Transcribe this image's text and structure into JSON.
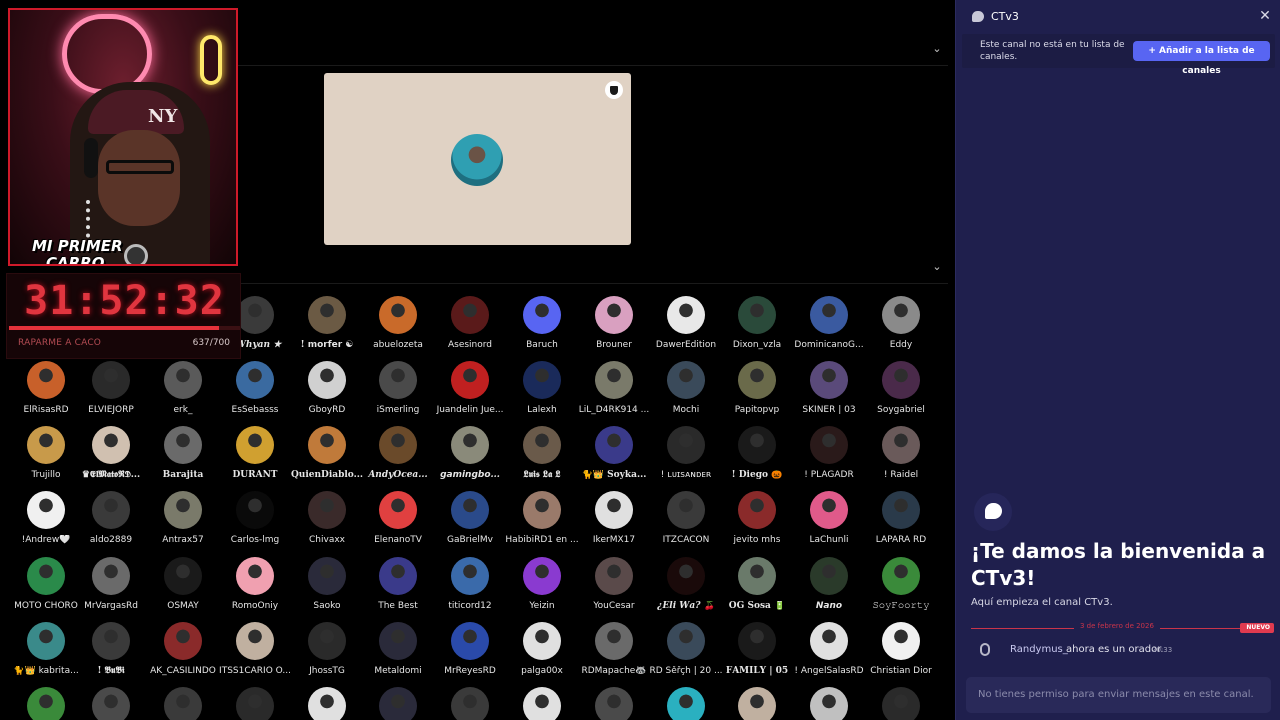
{
  "webcam": {
    "overlay_text_line1": "MI PRIMER",
    "overlay_text_line2": "CARRO",
    "cap_logo": "NY"
  },
  "timer": {
    "time": "31:52:32",
    "label": "RAPARME A CACO",
    "count": "637/700",
    "progress": 0.91
  },
  "stage": {
    "accent_color": "#e0d2c4"
  },
  "audience": {
    "members": [
      {
        "name": "! 𝑾𝒉𝒚𝒂𝒏 ★",
        "style": "italic",
        "color": "#3a3a3a"
      },
      {
        "name": "! 𝗺𝗼𝗿𝗳𝗲𝗿 ☯",
        "style": "bold",
        "color": "#6b5a44"
      },
      {
        "name": "abuelozeta",
        "style": "",
        "color": "#c96a2a"
      },
      {
        "name": "Asesinord",
        "style": "",
        "color": "#5a1a1a"
      },
      {
        "name": "Baruch",
        "style": "",
        "color": "#5865f2"
      },
      {
        "name": "Brouner",
        "style": "",
        "color": "#d9a0c0"
      },
      {
        "name": "DawerEdition",
        "style": "",
        "color": "#e8e8e8"
      },
      {
        "name": "Dixon_vzla",
        "style": "",
        "color": "#2a4a3a"
      },
      {
        "name": "DominicanoG...",
        "style": "",
        "color": "#3a5aa0"
      },
      {
        "name": "Eddy",
        "style": "",
        "color": "#8a8a8a"
      },
      {
        "name": "ElRisasRD",
        "style": "",
        "color": "#c8602a"
      },
      {
        "name": "ELVIEJORP",
        "style": "",
        "color": "#2a2a2a"
      },
      {
        "name": "erk_",
        "style": "",
        "color": "#5a5a5a"
      },
      {
        "name": "EsSebasss",
        "style": "",
        "color": "#3a6aa0"
      },
      {
        "name": "GboyRD",
        "style": "",
        "color": "#d0d0d0"
      },
      {
        "name": "iSmerling",
        "style": "",
        "color": "#4a4a4a"
      },
      {
        "name": "Juandelin Jue...",
        "style": "",
        "color": "#c02020"
      },
      {
        "name": "Lalexh",
        "style": "",
        "color": "#1a2a5a"
      },
      {
        "name": "LiL_D4RK914 ...",
        "style": "",
        "color": "#7a7a6a"
      },
      {
        "name": "Mochi",
        "style": "",
        "color": "#3a4a5a"
      },
      {
        "name": "Papitopvp",
        "style": "",
        "color": "#6a6a4a"
      },
      {
        "name": "SKINER | 03",
        "style": "",
        "color": "#5a4a7a"
      },
      {
        "name": "Soygabriel",
        "style": "",
        "color": "#4a2a4a"
      },
      {
        "name": "Trujillo",
        "style": "",
        "color": "#c89a4a"
      },
      {
        "name": "♛𝕰𝖑𝕸𝖆𝖙𝖔𝕽𝕯...",
        "style": "bold",
        "color": "#d0c0b0"
      },
      {
        "name": "Barajita",
        "style": "bold",
        "color": "#6a6a6a"
      },
      {
        "name": "DURANT",
        "style": "bold",
        "color": "#d0a030"
      },
      {
        "name": "QuienDiablo...",
        "style": "bold",
        "color": "#c07a3a"
      },
      {
        "name": "𝑨𝒏𝒅𝒚𝑶𝒄𝒆𝒂...",
        "style": "italic",
        "color": "#6a4a2a"
      },
      {
        "name": "𝙜𝙖𝙢𝙞𝙣𝙜𝙗𝙤...",
        "style": "italic",
        "color": "#8a8a7a"
      },
      {
        "name": "𝕷𝖚𝖎𝖘 𝕷𝖆 𝕷",
        "style": "bold",
        "color": "#6a5a4a"
      },
      {
        "name": "🐈👑 Soyka...",
        "style": "bold",
        "color": "#3a3a8a"
      },
      {
        "name": "! ʟᴜɪsᴀɴᴅᴇʀ",
        "style": "",
        "color": "#2a2a2a"
      },
      {
        "name": "! Diego 🎃",
        "style": "bold",
        "color": "#1a1a1a"
      },
      {
        "name": "! PLAGADR",
        "style": "",
        "color": "#2a1a1a"
      },
      {
        "name": "! Raidel",
        "style": "",
        "color": "#6a5a5a"
      },
      {
        "name": "!Andrew🤍",
        "style": "",
        "color": "#f0f0f0"
      },
      {
        "name": "aldo2889",
        "style": "",
        "color": "#3a3a3a"
      },
      {
        "name": "Antrax57",
        "style": "",
        "color": "#7a7a6a"
      },
      {
        "name": "Carlos-lmg",
        "style": "",
        "color": "#0a0a0a"
      },
      {
        "name": "Chivaxx",
        "style": "",
        "color": "#3a2a2a"
      },
      {
        "name": "ElenanoTV",
        "style": "",
        "color": "#e04040"
      },
      {
        "name": "GaBrielMv",
        "style": "",
        "color": "#2a4a8a"
      },
      {
        "name": "HabibiRD1 en ...",
        "style": "",
        "color": "#9a7a6a"
      },
      {
        "name": "IkerMX17",
        "style": "",
        "color": "#e0e0e0"
      },
      {
        "name": "ITZCACON",
        "style": "",
        "color": "#3a3a3a"
      },
      {
        "name": "jevito mhs",
        "style": "",
        "color": "#8a2a2a"
      },
      {
        "name": "LaChunli",
        "style": "",
        "color": "#e05a8a"
      },
      {
        "name": "LAPARA RD",
        "style": "",
        "color": "#2a3a4a"
      },
      {
        "name": "MOTO CHORO",
        "style": "",
        "color": "#2a8a4a"
      },
      {
        "name": "MrVargasRd",
        "style": "",
        "color": "#6a6a6a"
      },
      {
        "name": "OSMAY",
        "style": "",
        "color": "#1a1a1a"
      },
      {
        "name": "RomoOniy",
        "style": "",
        "color": "#f0a0b0"
      },
      {
        "name": "Saoko",
        "style": "",
        "color": "#2a2a3a"
      },
      {
        "name": "The Best",
        "style": "",
        "color": "#3a3a8a"
      },
      {
        "name": "titicord12",
        "style": "",
        "color": "#3a6aaa"
      },
      {
        "name": "Yeizin",
        "style": "",
        "color": "#8a3ad0"
      },
      {
        "name": "YouCesar",
        "style": "",
        "color": "#5a4a4a"
      },
      {
        "name": "¿𝑬𝒍𝒊 𝑾𝒂? 🍒",
        "style": "italic",
        "color": "#1a0a0a"
      },
      {
        "name": "OG Sosa 🔋",
        "style": "bold",
        "color": "#6a7a6a"
      },
      {
        "name": "𝙉𝙖𝙣𝙤",
        "style": "italic",
        "color": "#2a3a2a"
      },
      {
        "name": "𝚂𝚘𝚢𝙵𝚘𝚘𝚛𝚝𝚢",
        "style": "",
        "color": "#3a8a3a"
      },
      {
        "name": "🐈👑 kabrita...",
        "style": "",
        "color": "#3a8a8a"
      },
      {
        "name": "! 𝕭𝖚𝕭𝖎",
        "style": "bold",
        "color": "#3a3a3a"
      },
      {
        "name": "AK_CASILINDO",
        "style": "",
        "color": "#8a2a2a"
      },
      {
        "name": "ITSS1CARIO O...",
        "style": "",
        "color": "#c0b0a0"
      },
      {
        "name": "JhossTG",
        "style": "",
        "color": "#2a2a2a"
      },
      {
        "name": "Metaldomi",
        "style": "",
        "color": "#2a2a3a"
      },
      {
        "name": "MrReyesRD",
        "style": "",
        "color": "#2a4aaa"
      },
      {
        "name": "palga00x",
        "style": "",
        "color": "#e0e0e0"
      },
      {
        "name": "RDMapache🦝",
        "style": "",
        "color": "#6a6a6a"
      },
      {
        "name": "RD Šěřçh | 20 ...",
        "style": "",
        "color": "#3a4a5a"
      },
      {
        "name": "𝐅𝐀𝐌𝐈𝐋𝐘 | 05",
        "style": "bold",
        "color": "#1a1a1a"
      },
      {
        "name": "! AngelSalasRD",
        "style": "",
        "color": "#e0e0e0"
      },
      {
        "name": "Christian Dior",
        "style": "",
        "color": "#f0f0f0"
      },
      {
        "name": "",
        "style": "",
        "color": "#3a8a3a"
      },
      {
        "name": "",
        "style": "",
        "color": "#4a4a4a"
      },
      {
        "name": "",
        "style": "",
        "color": "#3a3a3a"
      },
      {
        "name": "",
        "style": "",
        "color": "#2a2a2a"
      },
      {
        "name": "",
        "style": "",
        "color": "#e0e0e0"
      },
      {
        "name": "",
        "style": "",
        "color": "#2a2a3a"
      },
      {
        "name": "",
        "style": "",
        "color": "#3a3a3a"
      },
      {
        "name": "",
        "style": "",
        "color": "#e0e0e0"
      },
      {
        "name": "",
        "style": "",
        "color": "#4a4a4a"
      },
      {
        "name": "",
        "style": "",
        "color": "#2ab0c0"
      },
      {
        "name": "",
        "style": "",
        "color": "#c0b0a0"
      },
      {
        "name": "",
        "style": "",
        "color": "#c0c0c0"
      },
      {
        "name": "",
        "style": "",
        "color": "#2a2a2a"
      }
    ]
  },
  "panel": {
    "title": "CTv3",
    "close_icon": "close-icon",
    "notice": "Este canal no está en tu lista de canales.",
    "add_button": "+ Añadir a la lista de canales",
    "welcome_title": "¡Te damos la bienvenida a CTv3!",
    "welcome_subtitle": "Aquí empieza el canal CTv3.",
    "divider_date": "3 de febrero de 2026",
    "new_badge": "NUEVO",
    "message": {
      "user": "Randymus_",
      "text": "ahora es un orador.",
      "time": "20:33"
    },
    "composer_placeholder": "No tienes permiso para enviar mensajes en este canal."
  },
  "colors": {
    "panel_bg": "#1f1f4d",
    "accent": "#5865f2",
    "timer_red": "#e0353f",
    "new_red": "#e03a4f"
  }
}
